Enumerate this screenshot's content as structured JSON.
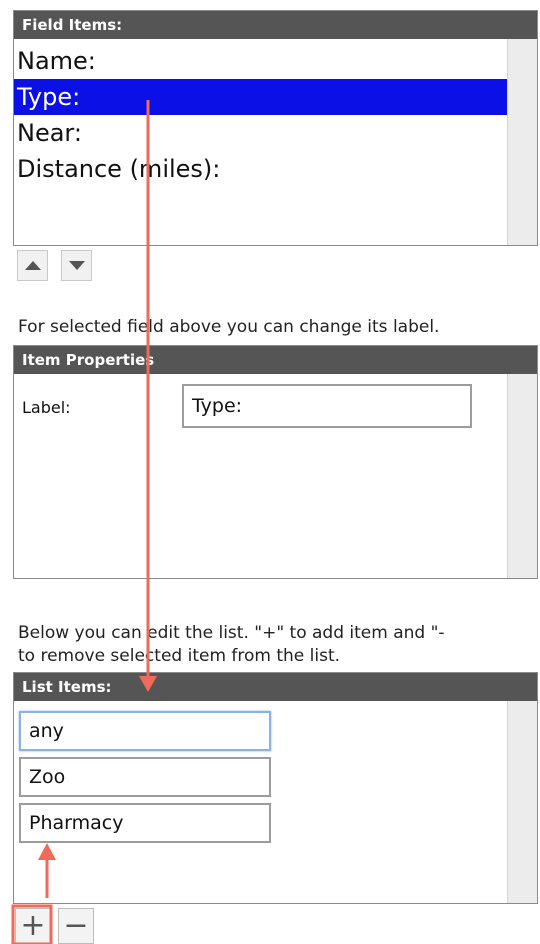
{
  "field_items": {
    "header": "Field Items:",
    "items": [
      {
        "label": "Name:"
      },
      {
        "label": "Type:",
        "selected": true
      },
      {
        "label": "Near:"
      },
      {
        "label": "Distance (miles):"
      }
    ]
  },
  "field_hint": "For selected field above you can change its label.",
  "item_properties": {
    "header": "Item Properties",
    "label_caption": "Label:",
    "label_value": "Type:"
  },
  "list_hint": {
    "line1": "Below you can edit the list. \"+\" to add item and \"-",
    "line2": "to remove selected item from the list."
  },
  "list_items": {
    "header": "List Items:",
    "items": [
      {
        "value": "any",
        "focused": true
      },
      {
        "value": "Zoo"
      },
      {
        "value": "Pharmacy"
      }
    ]
  },
  "buttons": {
    "move_up": "up-arrow-icon",
    "move_down": "down-arrow-icon",
    "add_label": "+",
    "remove_label": "−"
  },
  "colors": {
    "header_bg": "#555555",
    "selection_bg": "#0a10e6",
    "annotation": "#f06a5a",
    "focus_border": "#8ab2e6"
  }
}
